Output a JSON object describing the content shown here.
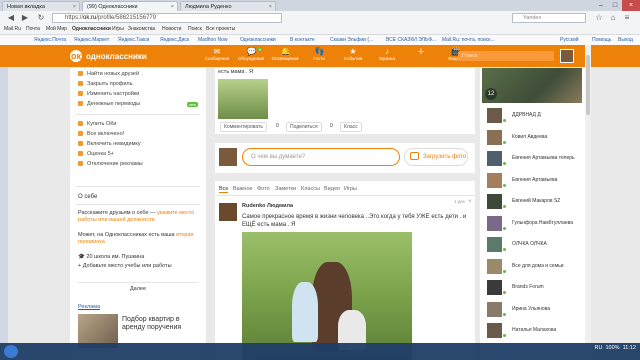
{
  "browser": {
    "tabs": [
      {
        "label": "Новая вкладка"
      },
      {
        "label": "(99) Одноклассники"
      },
      {
        "label": "Людмила Руденко"
      }
    ],
    "url_scheme": "https://",
    "url_host": "ok.ru",
    "url_path": "/profile/586215156779",
    "search_placeholder": "Yandex",
    "bookmarks": [
      "Mail.Ru",
      "Почта",
      "Мой Мир",
      "Одноклассники",
      "Игры",
      "Знакомства",
      "Новости",
      "Поиск",
      "Все проекты"
    ],
    "ybar": [
      "Яндекс.Почта",
      "Яндекс.Маркет",
      "Яндекс.Такси",
      "Яндекс.Диск",
      "Madhoo Now",
      "Одноклассники",
      "В контакте",
      "Сказки Эльфии (...",
      "ВСЕ СКАЗКИ ЭЛЬФ...",
      "Mail.Ru: почта, поиск...",
      "Русский",
      "Помощь",
      "Выход"
    ]
  },
  "ok_header": {
    "logo_glyph": "ок",
    "site_name": "одноклассники",
    "nav": [
      {
        "label": "Сообщения",
        "icon": "mail-icon",
        "glyph": "✉"
      },
      {
        "label": "Обсуждения",
        "icon": "chat-icon",
        "glyph": "💬",
        "badge": "9"
      },
      {
        "label": "Оповещения",
        "icon": "bell-icon",
        "glyph": "🔔"
      },
      {
        "label": "Гости",
        "icon": "footprint-icon",
        "glyph": "👣"
      },
      {
        "label": "События",
        "icon": "star-icon",
        "glyph": "★"
      },
      {
        "label": "Музыка",
        "icon": "music-icon",
        "glyph": "♪"
      },
      {
        "label": "",
        "icon": "plus-icon",
        "glyph": "＋"
      },
      {
        "label": "Видео",
        "icon": "video-icon",
        "glyph": "🎬"
      }
    ],
    "search_placeholder": "Поиск"
  },
  "left_menu": {
    "items1": [
      "Найти новых друзей",
      "Закрыть профиль",
      "Изменить настройки",
      "Денежные переводы"
    ],
    "new_badge": "new",
    "items2": [
      "Купить ОКи",
      "Все включено!",
      "Включить невидимку",
      "Оценка 5+",
      "Отключение рекламы"
    ],
    "about_title": "О себе",
    "about_text1": "Расскажите друзьям о себе — ",
    "about_link1": "укажите место работы или вашей должности",
    "about_text2": "Может, на Одноклассниках есть ваша ",
    "about_link2": "вторая половинка",
    "school": "20 школа им. Пушкина",
    "add_line": "Добавьте место учебы или работы",
    "more": "Далее",
    "ad_label": "Реклама",
    "ad_text": "Подбор квартир в аренду поручения"
  },
  "photo_card": {
    "caption": "есть мама . Я",
    "buttons": [
      "Комментировать",
      "Поделиться",
      "Класс"
    ],
    "counts": [
      "0",
      "0"
    ]
  },
  "status": {
    "placeholder": "О чем вы думаете?",
    "upload_label": "Загрузить фото"
  },
  "feed": {
    "tabs": [
      "Все",
      "Важное",
      "Фото",
      "Заметки",
      "Классы",
      "Видео",
      "Игры"
    ],
    "author": "Rudenko Людмила",
    "time": "1 дек",
    "text": "Самое прекрасное время в жизни человека ..Это когда у тебя УЖЕ есть дети . и ЕЩЁ есть мама . Я"
  },
  "right_col": {
    "photo_count": "12",
    "friends": [
      "ДДРВНАД Д",
      "Ковил Авдеева",
      "Евгения Артамьева теперь",
      "Евгения Артамьева",
      "Евгений Макаров SZ",
      "Гульнфора Намбтуллаева",
      "ОЛЧКА ОЛЧКА",
      "Все для дома и семьи",
      "Brands Forum",
      "Ирина Ульянова",
      "Наталья Малахова"
    ]
  },
  "taskbar": {
    "lang": "RU",
    "zoom": "100%",
    "time": "11:12"
  }
}
